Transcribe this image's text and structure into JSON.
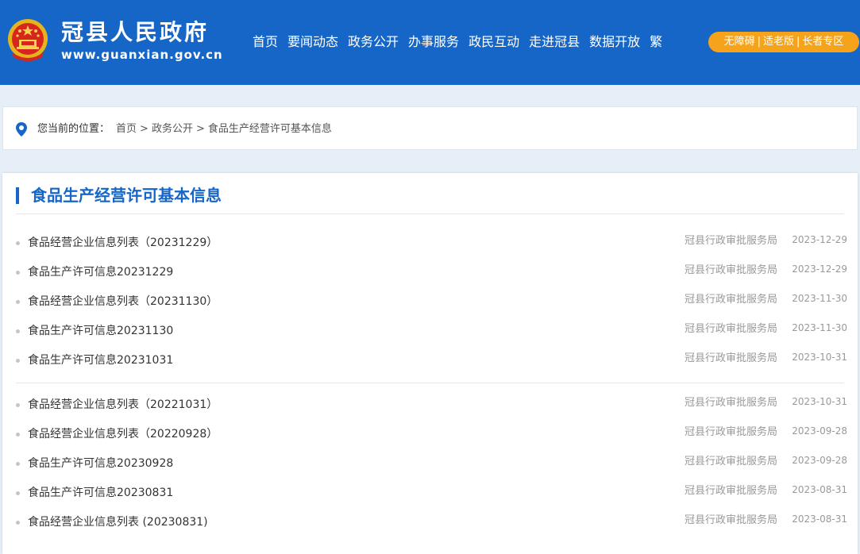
{
  "header": {
    "site_title": "冠县人民政府",
    "site_domain": "www.guanxian.gov.cn",
    "nav": [
      "首页",
      "要闻动态",
      "政务公开",
      "办事服务",
      "政民互动",
      "走进冠县",
      "数据开放",
      "繁"
    ],
    "accessibility": [
      "无障碍",
      "适老版",
      "长者专区"
    ],
    "accessibility_separator": "|"
  },
  "breadcrumb": {
    "prefix": "您当前的位置：",
    "items": [
      "首页",
      "政务公开",
      "食品生产经营许可基本信息"
    ],
    "separator": ">"
  },
  "panel": {
    "title": "食品生产经营许可基本信息",
    "groups": [
      [
        {
          "title": "食品经营企业信息列表（20231229）",
          "dept": "冠县行政审批服务局",
          "date": "2023-12-29"
        },
        {
          "title": "食品生产许可信息20231229",
          "dept": "冠县行政审批服务局",
          "date": "2023-12-29"
        },
        {
          "title": "食品经营企业信息列表（20231130）",
          "dept": "冠县行政审批服务局",
          "date": "2023-11-30"
        },
        {
          "title": "食品生产许可信息20231130",
          "dept": "冠县行政审批服务局",
          "date": "2023-11-30"
        },
        {
          "title": "食品生产许可信息20231031",
          "dept": "冠县行政审批服务局",
          "date": "2023-10-31"
        }
      ],
      [
        {
          "title": "食品经营企业信息列表（20221031）",
          "dept": "冠县行政审批服务局",
          "date": "2023-10-31"
        },
        {
          "title": "食品经营企业信息列表（20220928）",
          "dept": "冠县行政审批服务局",
          "date": "2023-09-28"
        },
        {
          "title": "食品生产许可信息20230928",
          "dept": "冠县行政审批服务局",
          "date": "2023-09-28"
        },
        {
          "title": "食品生产许可信息20230831",
          "dept": "冠县行政审批服务局",
          "date": "2023-08-31"
        },
        {
          "title": "食品经营企业信息列表 (20230831)",
          "dept": "冠县行政审批服务局",
          "date": "2023-08-31"
        }
      ]
    ]
  },
  "colors": {
    "brand_blue": "#1566c6",
    "accent_orange": "#f5a31a",
    "page_bg": "#e6eef8"
  },
  "icons": {
    "emblem": "national-emblem-icon",
    "location": "location-pin-icon"
  }
}
